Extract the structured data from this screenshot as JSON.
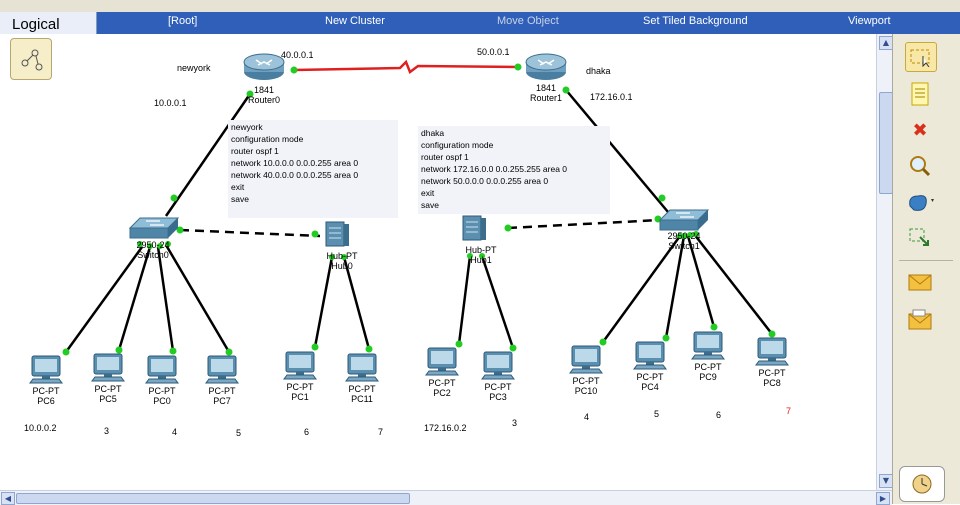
{
  "tab": {
    "logical": "Logical"
  },
  "menu": {
    "root": "[Root]",
    "new_cluster": "New Cluster",
    "move_object": "Move Object",
    "set_tiled_background": "Set Tiled Background",
    "viewport": "Viewport"
  },
  "labels": {
    "newyork": "newyork",
    "dhaka": "dhaka",
    "r0_ip": "40.0.0.1",
    "r1_ip": "50.0.0.1",
    "lan0_ip": "10.0.0.1",
    "lan1_ip": "172.16.0.1",
    "pc6_ip": "10.0.0.2",
    "pc2_ip": "172.16.0.2"
  },
  "notes": {
    "newyork": [
      "newyork",
      "configuration mode",
      "router ospf 1",
      "network 10.0.0.0 0.0.0.255 area 0",
      "network 40.0.0.0 0.0.0.255 area 0",
      "exit",
      "save"
    ],
    "dhaka": [
      "dhaka",
      "configuration mode",
      "router ospf 1",
      "network 172.16.0.0 0.0.255.255 area 0",
      "network 50.0.0.0 0.0.0.255 area 0",
      "exit",
      "save"
    ]
  },
  "routers": [
    {
      "model": "1841",
      "name": "Router0"
    },
    {
      "model": "1841",
      "name": "Router1"
    }
  ],
  "switches": [
    {
      "model": "2950-24",
      "name": "Switch0"
    },
    {
      "model": "2950-24",
      "name": "Switch1"
    }
  ],
  "hubs": [
    {
      "model": "Hub-PT",
      "name": "Hub0"
    },
    {
      "model": "Hub-PT",
      "name": "Hub1"
    }
  ],
  "pcs": [
    {
      "model": "PC-PT",
      "name": "PC6",
      "num": ""
    },
    {
      "model": "PC-PT",
      "name": "PC5",
      "num": "3"
    },
    {
      "model": "PC-PT",
      "name": "PC0",
      "num": "4"
    },
    {
      "model": "PC-PT",
      "name": "PC7",
      "num": "5"
    },
    {
      "model": "PC-PT",
      "name": "PC1",
      "num": "6"
    },
    {
      "model": "PC-PT",
      "name": "PC11",
      "num": "7"
    },
    {
      "model": "PC-PT",
      "name": "PC2",
      "num": ""
    },
    {
      "model": "PC-PT",
      "name": "PC3",
      "num": "3"
    },
    {
      "model": "PC-PT",
      "name": "PC10",
      "num": "4"
    },
    {
      "model": "PC-PT",
      "name": "PC4",
      "num": "5"
    },
    {
      "model": "PC-PT",
      "name": "PC9",
      "num": "6"
    },
    {
      "model": "PC-PT",
      "name": "PC8",
      "num": "7"
    }
  ],
  "tools": [
    "select-icon",
    "note-icon",
    "delete-icon",
    "inspect-icon",
    "draw-shape-icon",
    "resize-icon",
    "add-simple-pdu-icon",
    "add-complex-pdu-icon"
  ],
  "colors": {
    "serial_link": "#e02020",
    "link_light": "#22cc22",
    "menubar": "#2f5fb9",
    "device_blue": "#5a8fb0",
    "highlight_num": "#e02020"
  }
}
